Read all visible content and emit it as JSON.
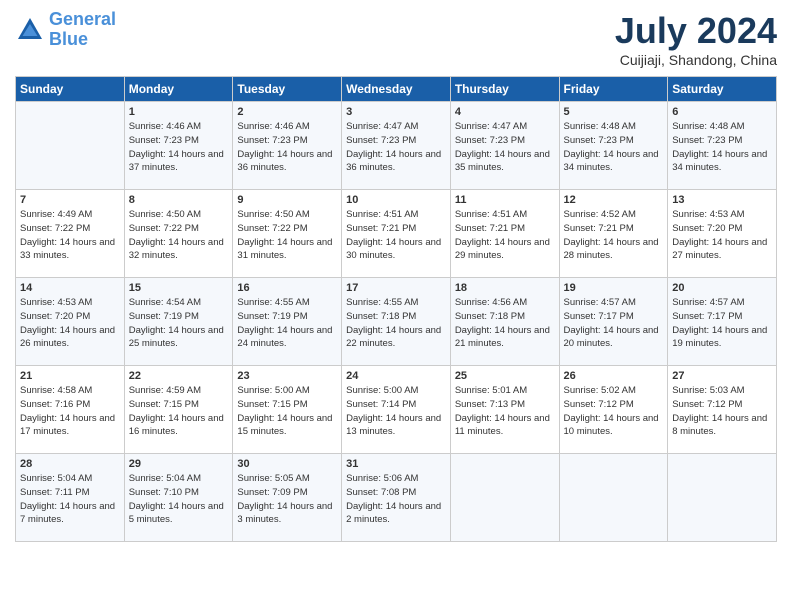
{
  "header": {
    "logo_line1": "General",
    "logo_line2": "Blue",
    "month": "July 2024",
    "location": "Cuijiaji, Shandong, China"
  },
  "weekdays": [
    "Sunday",
    "Monday",
    "Tuesday",
    "Wednesday",
    "Thursday",
    "Friday",
    "Saturday"
  ],
  "weeks": [
    [
      {
        "day": "",
        "sunrise": "",
        "sunset": "",
        "daylight": ""
      },
      {
        "day": "1",
        "sunrise": "Sunrise: 4:46 AM",
        "sunset": "Sunset: 7:23 PM",
        "daylight": "Daylight: 14 hours and 37 minutes."
      },
      {
        "day": "2",
        "sunrise": "Sunrise: 4:46 AM",
        "sunset": "Sunset: 7:23 PM",
        "daylight": "Daylight: 14 hours and 36 minutes."
      },
      {
        "day": "3",
        "sunrise": "Sunrise: 4:47 AM",
        "sunset": "Sunset: 7:23 PM",
        "daylight": "Daylight: 14 hours and 36 minutes."
      },
      {
        "day": "4",
        "sunrise": "Sunrise: 4:47 AM",
        "sunset": "Sunset: 7:23 PM",
        "daylight": "Daylight: 14 hours and 35 minutes."
      },
      {
        "day": "5",
        "sunrise": "Sunrise: 4:48 AM",
        "sunset": "Sunset: 7:23 PM",
        "daylight": "Daylight: 14 hours and 34 minutes."
      },
      {
        "day": "6",
        "sunrise": "Sunrise: 4:48 AM",
        "sunset": "Sunset: 7:23 PM",
        "daylight": "Daylight: 14 hours and 34 minutes."
      }
    ],
    [
      {
        "day": "7",
        "sunrise": "Sunrise: 4:49 AM",
        "sunset": "Sunset: 7:22 PM",
        "daylight": "Daylight: 14 hours and 33 minutes."
      },
      {
        "day": "8",
        "sunrise": "Sunrise: 4:50 AM",
        "sunset": "Sunset: 7:22 PM",
        "daylight": "Daylight: 14 hours and 32 minutes."
      },
      {
        "day": "9",
        "sunrise": "Sunrise: 4:50 AM",
        "sunset": "Sunset: 7:22 PM",
        "daylight": "Daylight: 14 hours and 31 minutes."
      },
      {
        "day": "10",
        "sunrise": "Sunrise: 4:51 AM",
        "sunset": "Sunset: 7:21 PM",
        "daylight": "Daylight: 14 hours and 30 minutes."
      },
      {
        "day": "11",
        "sunrise": "Sunrise: 4:51 AM",
        "sunset": "Sunset: 7:21 PM",
        "daylight": "Daylight: 14 hours and 29 minutes."
      },
      {
        "day": "12",
        "sunrise": "Sunrise: 4:52 AM",
        "sunset": "Sunset: 7:21 PM",
        "daylight": "Daylight: 14 hours and 28 minutes."
      },
      {
        "day": "13",
        "sunrise": "Sunrise: 4:53 AM",
        "sunset": "Sunset: 7:20 PM",
        "daylight": "Daylight: 14 hours and 27 minutes."
      }
    ],
    [
      {
        "day": "14",
        "sunrise": "Sunrise: 4:53 AM",
        "sunset": "Sunset: 7:20 PM",
        "daylight": "Daylight: 14 hours and 26 minutes."
      },
      {
        "day": "15",
        "sunrise": "Sunrise: 4:54 AM",
        "sunset": "Sunset: 7:19 PM",
        "daylight": "Daylight: 14 hours and 25 minutes."
      },
      {
        "day": "16",
        "sunrise": "Sunrise: 4:55 AM",
        "sunset": "Sunset: 7:19 PM",
        "daylight": "Daylight: 14 hours and 24 minutes."
      },
      {
        "day": "17",
        "sunrise": "Sunrise: 4:55 AM",
        "sunset": "Sunset: 7:18 PM",
        "daylight": "Daylight: 14 hours and 22 minutes."
      },
      {
        "day": "18",
        "sunrise": "Sunrise: 4:56 AM",
        "sunset": "Sunset: 7:18 PM",
        "daylight": "Daylight: 14 hours and 21 minutes."
      },
      {
        "day": "19",
        "sunrise": "Sunrise: 4:57 AM",
        "sunset": "Sunset: 7:17 PM",
        "daylight": "Daylight: 14 hours and 20 minutes."
      },
      {
        "day": "20",
        "sunrise": "Sunrise: 4:57 AM",
        "sunset": "Sunset: 7:17 PM",
        "daylight": "Daylight: 14 hours and 19 minutes."
      }
    ],
    [
      {
        "day": "21",
        "sunrise": "Sunrise: 4:58 AM",
        "sunset": "Sunset: 7:16 PM",
        "daylight": "Daylight: 14 hours and 17 minutes."
      },
      {
        "day": "22",
        "sunrise": "Sunrise: 4:59 AM",
        "sunset": "Sunset: 7:15 PM",
        "daylight": "Daylight: 14 hours and 16 minutes."
      },
      {
        "day": "23",
        "sunrise": "Sunrise: 5:00 AM",
        "sunset": "Sunset: 7:15 PM",
        "daylight": "Daylight: 14 hours and 15 minutes."
      },
      {
        "day": "24",
        "sunrise": "Sunrise: 5:00 AM",
        "sunset": "Sunset: 7:14 PM",
        "daylight": "Daylight: 14 hours and 13 minutes."
      },
      {
        "day": "25",
        "sunrise": "Sunrise: 5:01 AM",
        "sunset": "Sunset: 7:13 PM",
        "daylight": "Daylight: 14 hours and 11 minutes."
      },
      {
        "day": "26",
        "sunrise": "Sunrise: 5:02 AM",
        "sunset": "Sunset: 7:12 PM",
        "daylight": "Daylight: 14 hours and 10 minutes."
      },
      {
        "day": "27",
        "sunrise": "Sunrise: 5:03 AM",
        "sunset": "Sunset: 7:12 PM",
        "daylight": "Daylight: 14 hours and 8 minutes."
      }
    ],
    [
      {
        "day": "28",
        "sunrise": "Sunrise: 5:04 AM",
        "sunset": "Sunset: 7:11 PM",
        "daylight": "Daylight: 14 hours and 7 minutes."
      },
      {
        "day": "29",
        "sunrise": "Sunrise: 5:04 AM",
        "sunset": "Sunset: 7:10 PM",
        "daylight": "Daylight: 14 hours and 5 minutes."
      },
      {
        "day": "30",
        "sunrise": "Sunrise: 5:05 AM",
        "sunset": "Sunset: 7:09 PM",
        "daylight": "Daylight: 14 hours and 3 minutes."
      },
      {
        "day": "31",
        "sunrise": "Sunrise: 5:06 AM",
        "sunset": "Sunset: 7:08 PM",
        "daylight": "Daylight: 14 hours and 2 minutes."
      },
      {
        "day": "",
        "sunrise": "",
        "sunset": "",
        "daylight": ""
      },
      {
        "day": "",
        "sunrise": "",
        "sunset": "",
        "daylight": ""
      },
      {
        "day": "",
        "sunrise": "",
        "sunset": "",
        "daylight": ""
      }
    ]
  ]
}
